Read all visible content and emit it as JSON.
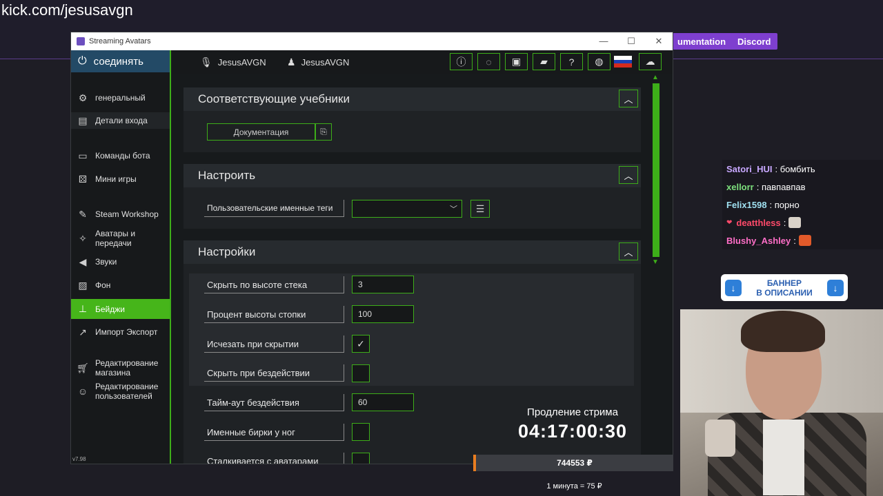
{
  "site": {
    "url": "kick.com/jesusavgn",
    "buttons": [
      "umentation",
      "Discord"
    ]
  },
  "window": {
    "title": "Streaming Avatars",
    "controls": {
      "minimize": "—",
      "maximize": "☐",
      "close": "✕"
    }
  },
  "sidebar": {
    "connect": "соединять",
    "items": [
      {
        "label": "генеральный",
        "icon": "gear-icon"
      },
      {
        "label": "Детали входа",
        "icon": "login-icon"
      },
      {
        "label": "Команды бота",
        "icon": "terminal-icon"
      },
      {
        "label": "Мини игры",
        "icon": "dice-icon"
      },
      {
        "label": "Steam Workshop",
        "icon": "steam-icon"
      },
      {
        "label": "Аватары и передачи",
        "icon": "avatar-icon"
      },
      {
        "label": "Звуки",
        "icon": "speaker-icon"
      },
      {
        "label": "Фон",
        "icon": "image-icon"
      },
      {
        "label": "Бейджи",
        "icon": "badge-icon"
      },
      {
        "label": "Импорт Экспорт",
        "icon": "export-icon"
      },
      {
        "label": "Редактирование магазина",
        "icon": "cart-icon"
      },
      {
        "label": "Редактирование пользователей",
        "icon": "user-icon"
      }
    ],
    "active_index": 8,
    "version": "v7.98"
  },
  "topbar": {
    "account1": "JesusAVGN",
    "account2": "JesusAVGN",
    "buttons": [
      "alert-icon",
      "refresh-icon",
      "save-icon",
      "folder-icon",
      "help-icon",
      "globe-icon",
      "flag-ru-icon",
      "cloud-icon"
    ]
  },
  "sections": {
    "tutorials": {
      "title": "Соответствующие учебники",
      "doc_button": "Документация"
    },
    "customize": {
      "title": "Настроить",
      "nametags_label": "Пользовательские именные теги",
      "nametags_value": ""
    },
    "settings": {
      "title": "Настройки",
      "rows": [
        {
          "label": "Скрыть по высоте стека",
          "type": "input",
          "value": "3"
        },
        {
          "label": "Процент высоты стопки",
          "type": "input",
          "value": "100"
        },
        {
          "label": "Исчезать при скрытии",
          "type": "check",
          "value": "✓"
        },
        {
          "label": "Скрыть при бездействии",
          "type": "check",
          "value": ""
        },
        {
          "label": "Тайм-аут бездействия",
          "type": "input",
          "value": "60"
        },
        {
          "label": "Именные бирки у ног",
          "type": "check",
          "value": ""
        },
        {
          "label": "Сталкивается с аватарами",
          "type": "check",
          "value": ""
        }
      ]
    }
  },
  "overlay": {
    "timer_title": "Продление стрима",
    "timer_value": "04:17:00:30",
    "money": "744553 ₽",
    "rate": "1 минута = 75 ₽"
  },
  "chat": [
    {
      "user": "Satori_HUI",
      "text": ": бомбить",
      "color": "#c8a8ff"
    },
    {
      "user": "xellorr",
      "text": ": павпавпав",
      "color": "#7de07d"
    },
    {
      "user": "Felix1598",
      "text": ": порно",
      "color": "#9fe0f0"
    },
    {
      "user": "deatthless",
      "text": ":",
      "color": "#ff4a6a",
      "emote": "#d9d2c8"
    },
    {
      "user": "Blushy_Ashley",
      "text": ":",
      "color": "#ff6ec7",
      "emote": "#e25a2a"
    }
  ],
  "banner": {
    "line1": "БАННЕР",
    "line2": "В ОПИСАНИИ"
  },
  "colors": {
    "accent": "#3dae19",
    "active": "#46b51a",
    "connect": "#234a66",
    "site_purple": "#7e3fcf"
  }
}
